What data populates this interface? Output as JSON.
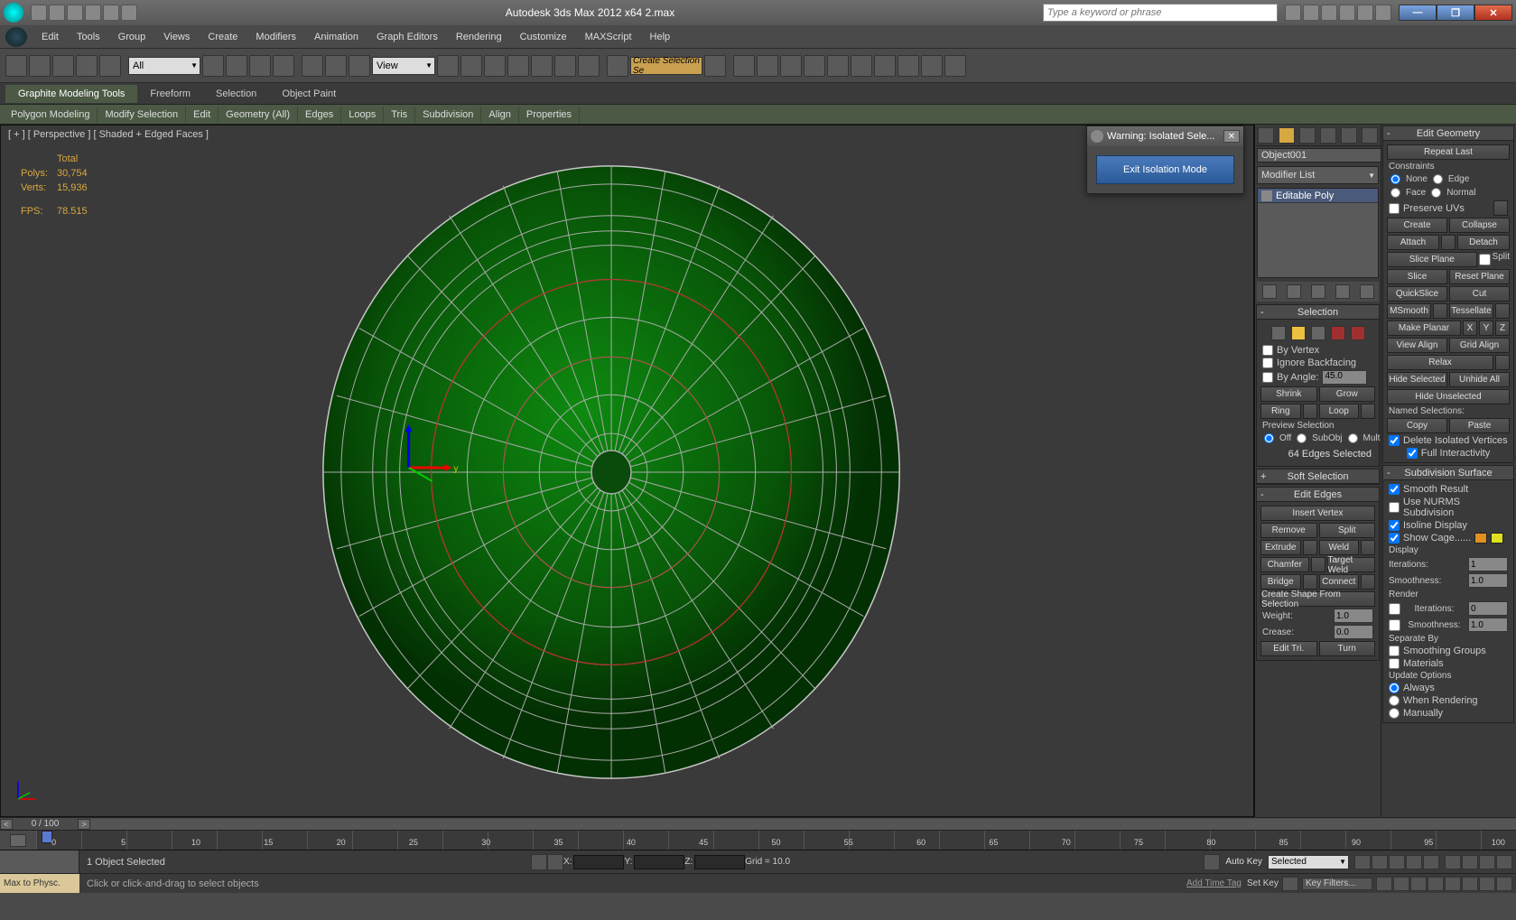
{
  "titlebar": {
    "title": "Autodesk 3ds Max 2012 x64    2.max",
    "search_placeholder": "Type a keyword or phrase"
  },
  "menu": [
    "Edit",
    "Tools",
    "Group",
    "Views",
    "Create",
    "Modifiers",
    "Animation",
    "Graph Editors",
    "Rendering",
    "Customize",
    "MAXScript",
    "Help"
  ],
  "toolbar": {
    "filter": "All",
    "view": "View",
    "selection_input": "Create Selection Se"
  },
  "ribbon": {
    "tabs": [
      "Graphite Modeling Tools",
      "Freeform",
      "Selection",
      "Object Paint"
    ],
    "sub": [
      "Polygon Modeling",
      "Modify Selection",
      "Edit",
      "Geometry (All)",
      "Edges",
      "Loops",
      "Tris",
      "Subdivision",
      "Align",
      "Properties"
    ]
  },
  "viewport": {
    "label": "[ + ] [ Perspective ] [ Shaded + Edged Faces ]",
    "stats_head": "Total",
    "polys_label": "Polys:",
    "polys": "30,754",
    "verts_label": "Verts:",
    "verts": "15,936",
    "fps_label": "FPS:",
    "fps": "78.515"
  },
  "warning": {
    "title": "Warning: Isolated Sele...",
    "button": "Exit Isolation Mode"
  },
  "cmdpanel": {
    "object_name": "Object001",
    "modifier_list": "Modifier List",
    "stack_item": "Editable Poly",
    "selection": {
      "head": "Selection",
      "by_vertex": "By Vertex",
      "ignore_bf": "Ignore Backfacing",
      "by_angle": "By Angle:",
      "angle": "45.0",
      "shrink": "Shrink",
      "grow": "Grow",
      "ring": "Ring",
      "loop": "Loop",
      "preview": "Preview Selection",
      "off": "Off",
      "subobj": "SubObj",
      "multi": "Multi",
      "status": "64 Edges Selected"
    },
    "soft_sel": "Soft Selection",
    "edit_edges": {
      "head": "Edit Edges",
      "insert_vertex": "Insert Vertex",
      "remove": "Remove",
      "split": "Split",
      "extrude": "Extrude",
      "weld": "Weld",
      "chamfer": "Chamfer",
      "target_weld": "Target Weld",
      "bridge": "Bridge",
      "connect": "Connect",
      "create_shape": "Create Shape From Selection",
      "weight": "Weight:",
      "weight_val": "1.0",
      "crease": "Crease:",
      "crease_val": "0.0",
      "edit_tri": "Edit Tri.",
      "turn": "Turn"
    },
    "edit_geom": {
      "head": "Edit Geometry",
      "repeat": "Repeat Last",
      "constraints": "Constraints",
      "none": "None",
      "edge": "Edge",
      "face": "Face",
      "normal": "Normal",
      "preserve_uvs": "Preserve UVs",
      "create": "Create",
      "collapse": "Collapse",
      "attach": "Attach",
      "detach": "Detach",
      "slice_plane": "Slice Plane",
      "split": "Split",
      "slice": "Slice",
      "reset_plane": "Reset Plane",
      "quickslice": "QuickSlice",
      "cut": "Cut",
      "msmooth": "MSmooth",
      "tessellate": "Tessellate",
      "make_planar": "Make Planar",
      "view_align": "View Align",
      "grid_align": "Grid Align",
      "relax": "Relax",
      "hide_sel": "Hide Selected",
      "unhide_all": "Unhide All",
      "hide_unsel": "Hide Unselected",
      "named_sel": "Named Selections:",
      "copy": "Copy",
      "paste": "Paste",
      "del_iso": "Delete Isolated Vertices",
      "full_int": "Full Interactivity"
    },
    "subdiv": {
      "head": "Subdivision Surface",
      "smooth": "Smooth Result",
      "nurms": "Use NURMS Subdivision",
      "isoline": "Isoline Display",
      "show_cage": "Show Cage......",
      "display": "Display",
      "iter": "Iterations:",
      "iter_val": "1",
      "smoothness": "Smoothness:",
      "smooth_val": "1.0",
      "render": "Render",
      "r_iter_val": "0",
      "r_smooth_val": "1.0",
      "sep_by": "Separate By",
      "sgroups": "Smoothing Groups",
      "materials": "Materials",
      "update": "Update Options",
      "always": "Always",
      "when_render": "When Rendering",
      "manually": "Manually"
    }
  },
  "timeline": {
    "pos": "0 / 100"
  },
  "status": {
    "sel": "1 Object Selected",
    "grid": "Grid = 10.0",
    "autokey": "Auto Key",
    "setkey": "Set Key",
    "selected": "Selected",
    "keyfilters": "Key Filters..."
  },
  "hint": {
    "left": "Max to Physc.",
    "msg": "Click or click-and-drag to select objects",
    "add_tag": "Add Time Tag"
  }
}
